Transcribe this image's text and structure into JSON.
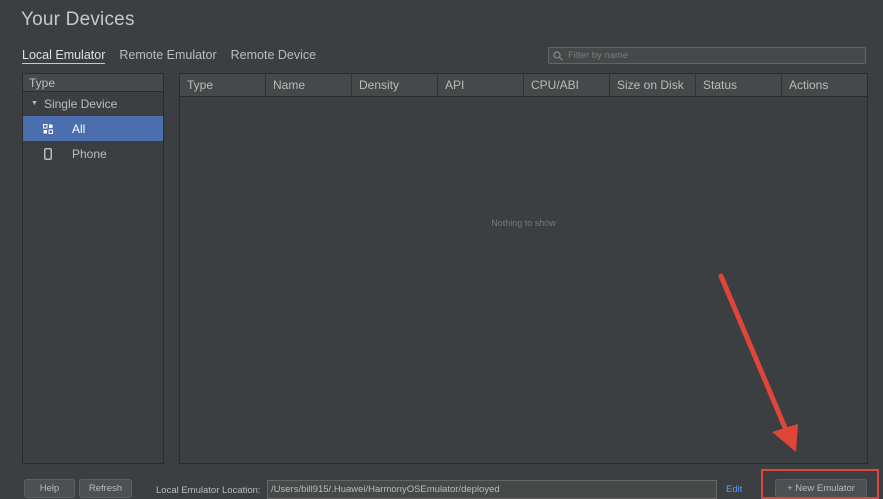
{
  "page_title": "Your Devices",
  "tabs": [
    {
      "label": "Local Emulator",
      "active": true
    },
    {
      "label": "Remote Emulator",
      "active": false
    },
    {
      "label": "Remote Device",
      "active": false
    }
  ],
  "search": {
    "placeholder": "Filter by name"
  },
  "sidebar": {
    "header": "Type",
    "group": "Single Device",
    "items": [
      {
        "label": "All",
        "icon": "all-devices-icon",
        "selected": true
      },
      {
        "label": "Phone",
        "icon": "phone-icon",
        "selected": false
      }
    ]
  },
  "table": {
    "columns": [
      "Type",
      "Name",
      "Density",
      "API",
      "CPU/ABI",
      "Size on Disk",
      "Status",
      "Actions"
    ],
    "empty_text": "Nothing to show"
  },
  "footer": {
    "help_label": "Help",
    "refresh_label": "Refresh",
    "location_label": "Local Emulator Location:",
    "location_value": "/Users/bill915/.Huawei/HarmonyOSEmulator/deployed",
    "edit_label": "Edit",
    "new_emulator_label": "+ New Emulator"
  },
  "colors": {
    "background": "#3c3f41",
    "selection": "#4b6eaf",
    "link": "#589df6",
    "annotation": "#e0453a"
  }
}
